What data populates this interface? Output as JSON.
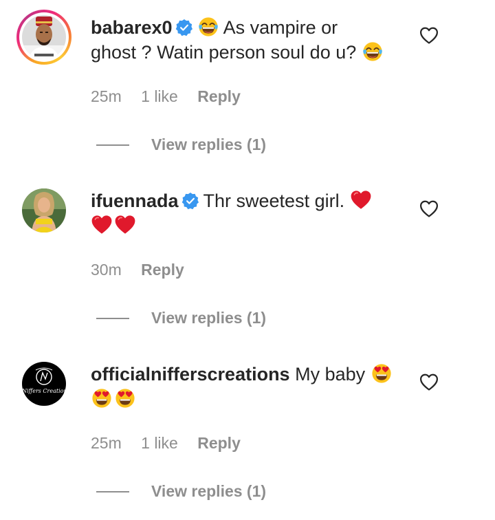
{
  "comments": [
    {
      "username": "babarex0",
      "verified": true,
      "text_line1_prefix_emoji": "face-with-tears-of-joy",
      "text_line1": "As vampire or",
      "text_line2": "ghost ? Watin person soul do u?",
      "text_line2_suffix_emoji": "face-with-tears-of-joy",
      "time": "25m",
      "likes": "1 like",
      "reply_label": "Reply",
      "view_replies": "View replies (1)"
    },
    {
      "username": "ifuennada",
      "verified": true,
      "text_line1": "Thr sweetest girl.",
      "text_line1_suffix_emoji": "red-heart",
      "text_line2_emojis": [
        "red-heart",
        "red-heart"
      ],
      "time": "30m",
      "reply_label": "Reply",
      "view_replies": "View replies (1)"
    },
    {
      "username": "officialnifferscreations",
      "verified": false,
      "text_line1": "My baby",
      "text_line1_suffix_emoji": "smiling-face-with-heart-eyes",
      "text_line2_emojis": [
        "smiling-face-with-heart-eyes",
        "smiling-face-with-heart-eyes"
      ],
      "avatar_logo_text": "Niffers Creation",
      "time": "25m",
      "likes": "1 like",
      "reply_label": "Reply",
      "view_replies": "View replies (1)"
    }
  ],
  "colors": {
    "text": "#262626",
    "muted": "#8e8e8e",
    "verified_blue": "#3897f0",
    "heart_red": "#e0192c"
  }
}
